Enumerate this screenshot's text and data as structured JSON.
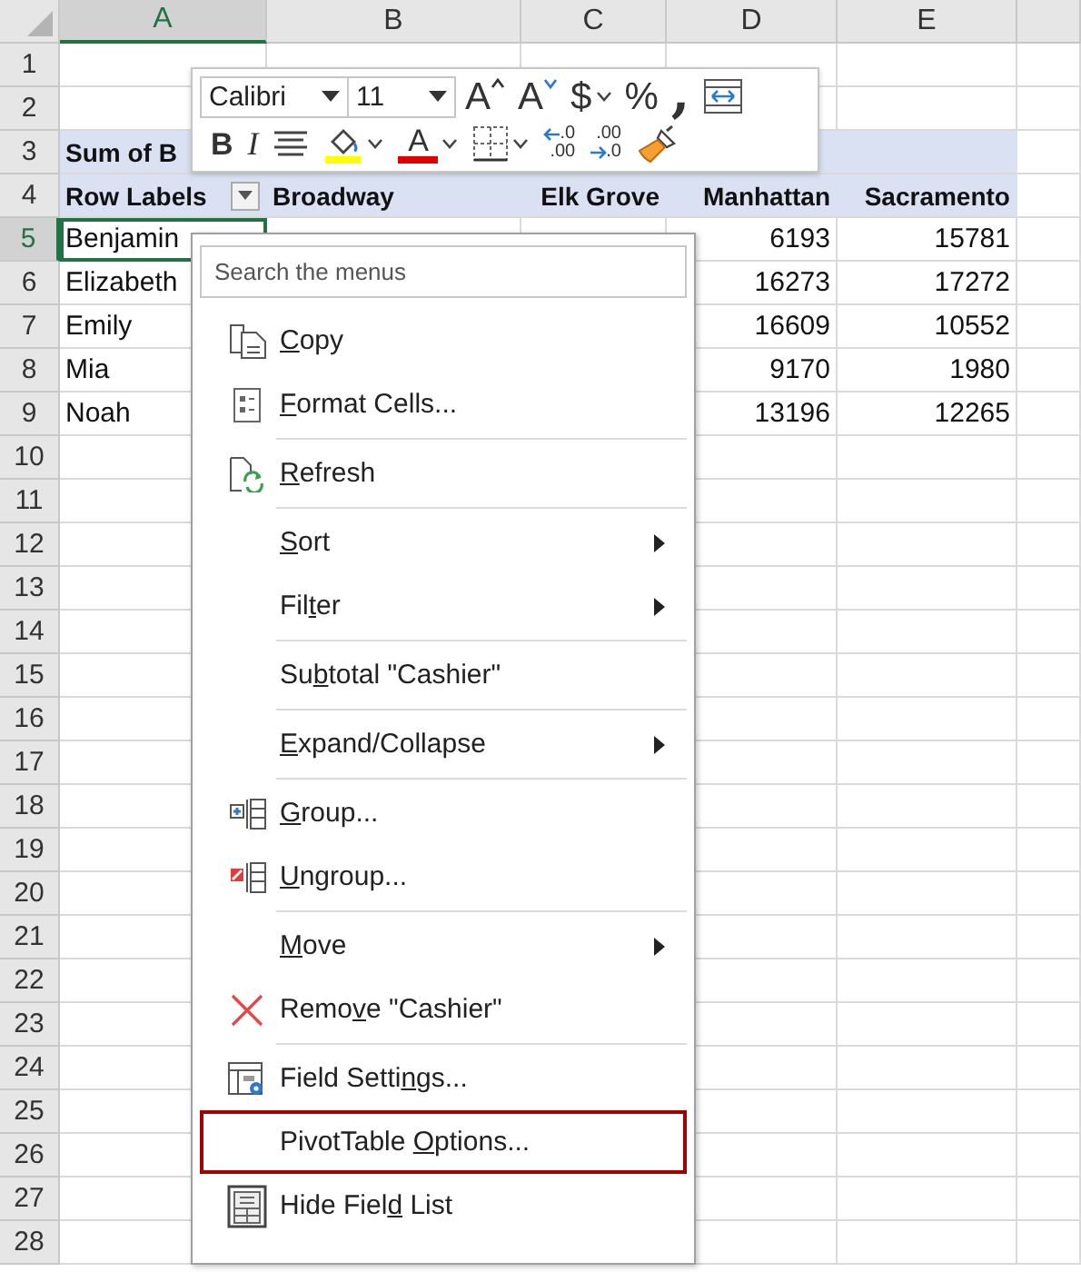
{
  "sheet": {
    "columns": [
      {
        "label": "A",
        "selected": true
      },
      {
        "label": "B",
        "selected": false
      },
      {
        "label": "C",
        "selected": false
      },
      {
        "label": "D",
        "selected": false
      },
      {
        "label": "E",
        "selected": false
      }
    ],
    "rows": [
      {
        "number": "1",
        "selected": false,
        "kind": "plain"
      },
      {
        "number": "2",
        "selected": false,
        "kind": "plain"
      },
      {
        "number": "3",
        "selected": false,
        "kind": "pivot-header",
        "cells": [
          {
            "text": "Sum of B",
            "kind": "label",
            "active": false
          }
        ]
      },
      {
        "number": "4",
        "selected": false,
        "kind": "pivot-header",
        "cells": [
          {
            "text": "Row Labels",
            "kind": "label",
            "active": false,
            "filter_button": true
          },
          {
            "text": "Broadway",
            "kind": "label",
            "active": false,
            "filter_button": false
          },
          {
            "text": "Elk Grove",
            "kind": "value",
            "active": false,
            "filter_button": false
          },
          {
            "text": "Manhattan",
            "kind": "value",
            "active": false,
            "filter_button": false
          },
          {
            "text": "Sacramento",
            "kind": "value",
            "active": false,
            "filter_button": false
          }
        ]
      },
      {
        "number": "5",
        "selected": true,
        "kind": "plain",
        "cells": [
          {
            "text": "Benjamin",
            "kind": "label",
            "active": true
          },
          null,
          null,
          {
            "text": "6193",
            "kind": "value",
            "active": false
          },
          {
            "text": "15781",
            "kind": "value",
            "active": false
          }
        ]
      },
      {
        "number": "6",
        "selected": false,
        "kind": "plain",
        "cells": [
          {
            "text": "Elizabeth",
            "kind": "label",
            "active": false
          },
          null,
          null,
          {
            "text": "16273",
            "kind": "value",
            "active": false
          },
          {
            "text": "17272",
            "kind": "value",
            "active": false
          }
        ]
      },
      {
        "number": "7",
        "selected": false,
        "kind": "plain",
        "cells": [
          {
            "text": "Emily",
            "kind": "label",
            "active": false
          },
          null,
          null,
          {
            "text": "16609",
            "kind": "value",
            "active": false
          },
          {
            "text": "10552",
            "kind": "value",
            "active": false
          }
        ]
      },
      {
        "number": "8",
        "selected": false,
        "kind": "plain",
        "cells": [
          {
            "text": "Mia",
            "kind": "label",
            "active": false
          },
          null,
          null,
          {
            "text": "9170",
            "kind": "value",
            "active": false
          },
          {
            "text": "1980",
            "kind": "value",
            "active": false
          }
        ]
      },
      {
        "number": "9",
        "selected": false,
        "kind": "plain",
        "cells": [
          {
            "text": "Noah",
            "kind": "label",
            "active": false
          },
          null,
          null,
          {
            "text": "13196",
            "kind": "value",
            "active": false
          },
          {
            "text": "12265",
            "kind": "value",
            "active": false
          }
        ]
      },
      {
        "number": "10",
        "selected": false,
        "kind": "plain"
      },
      {
        "number": "11",
        "selected": false,
        "kind": "plain"
      },
      {
        "number": "12",
        "selected": false,
        "kind": "plain"
      },
      {
        "number": "13",
        "selected": false,
        "kind": "plain"
      },
      {
        "number": "14",
        "selected": false,
        "kind": "plain"
      },
      {
        "number": "15",
        "selected": false,
        "kind": "plain"
      },
      {
        "number": "16",
        "selected": false,
        "kind": "plain"
      },
      {
        "number": "17",
        "selected": false,
        "kind": "plain"
      },
      {
        "number": "18",
        "selected": false,
        "kind": "plain"
      },
      {
        "number": "19",
        "selected": false,
        "kind": "plain"
      },
      {
        "number": "20",
        "selected": false,
        "kind": "plain"
      },
      {
        "number": "21",
        "selected": false,
        "kind": "plain"
      },
      {
        "number": "22",
        "selected": false,
        "kind": "plain"
      },
      {
        "number": "23",
        "selected": false,
        "kind": "plain"
      },
      {
        "number": "24",
        "selected": false,
        "kind": "plain"
      },
      {
        "number": "25",
        "selected": false,
        "kind": "plain"
      },
      {
        "number": "26",
        "selected": false,
        "kind": "plain"
      },
      {
        "number": "27",
        "selected": false,
        "kind": "plain"
      },
      {
        "number": "28",
        "selected": false,
        "kind": "plain"
      }
    ]
  },
  "mini_toolbar": {
    "font": {
      "value": "Calibri"
    },
    "size": {
      "value": "11"
    },
    "row_1": [
      {
        "kind": "grow-font",
        "glyph": "A",
        "dropdown": false
      },
      {
        "kind": "shrink-font",
        "glyph": "A",
        "dropdown": false
      },
      {
        "kind": "currency",
        "glyph": "$",
        "dropdown": true
      },
      {
        "kind": "percent",
        "glyph": "%",
        "dropdown": false
      },
      {
        "kind": "comma",
        "glyph": ",",
        "dropdown": false
      },
      {
        "kind": "wrap",
        "dropdown": false
      }
    ],
    "row_2": [
      {
        "kind": "bold",
        "glyph": "B",
        "dropdown": false
      },
      {
        "kind": "italic",
        "glyph": "I",
        "dropdown": false
      },
      {
        "kind": "align",
        "dropdown": false
      },
      {
        "kind": "fill-color",
        "dropdown": true
      },
      {
        "kind": "font-color",
        "glyph": "A",
        "dropdown": true
      },
      {
        "kind": "borders",
        "dropdown": true
      },
      {
        "kind": "increase-decimal",
        "top": ".0",
        "bottom": ".00",
        "dropdown": false
      },
      {
        "kind": "decrease-decimal",
        "top": ".00",
        "bottom": ".0",
        "dropdown": false
      },
      {
        "kind": "format-painter",
        "dropdown": false
      }
    ]
  },
  "context_menu": {
    "search": {
      "placeholder": "Search the menus"
    },
    "items": [
      {
        "kind": "copy",
        "key": "C",
        "post": "opy",
        "submenu": false,
        "highlighted": false
      },
      {
        "kind": "format-cells",
        "key": "F",
        "post": "ormat Cells...",
        "submenu": false,
        "highlighted": false
      },
      {
        "kind": "separator"
      },
      {
        "kind": "refresh",
        "key": "R",
        "post": "efresh",
        "submenu": false,
        "highlighted": false
      },
      {
        "kind": "separator"
      },
      {
        "kind": "plain",
        "key": "S",
        "post": "ort",
        "submenu": true,
        "highlighted": false
      },
      {
        "kind": "plain",
        "pre": "Fil",
        "key": "t",
        "post": "er",
        "submenu": true,
        "highlighted": false
      },
      {
        "kind": "separator"
      },
      {
        "kind": "plain",
        "pre": "Su",
        "key": "b",
        "post": "total \"Cashier\"",
        "submenu": false,
        "highlighted": false
      },
      {
        "kind": "separator"
      },
      {
        "kind": "plain",
        "key": "E",
        "post": "xpand/Collapse",
        "submenu": true,
        "highlighted": false
      },
      {
        "kind": "separator"
      },
      {
        "kind": "group",
        "key": "G",
        "post": "roup...",
        "submenu": false,
        "highlighted": false
      },
      {
        "kind": "ungroup",
        "key": "U",
        "post": "ngroup...",
        "submenu": false,
        "highlighted": false
      },
      {
        "kind": "separator"
      },
      {
        "kind": "plain",
        "key": "M",
        "post": "ove",
        "submenu": true,
        "highlighted": false
      },
      {
        "kind": "remove",
        "pre": "Remo",
        "key": "v",
        "post": "e \"Cashier\"",
        "submenu": false,
        "highlighted": false
      },
      {
        "kind": "separator"
      },
      {
        "kind": "field-settings",
        "pre": "Field Setti",
        "key": "n",
        "post": "gs...",
        "submenu": false,
        "highlighted": false
      },
      {
        "kind": "plain",
        "pre": "PivotTable ",
        "key": "O",
        "post": "ptions...",
        "submenu": false,
        "highlighted": true
      },
      {
        "kind": "field-list",
        "pre": "Hide Fiel",
        "key": "d",
        "post": " List",
        "submenu": false,
        "highlighted": false
      }
    ]
  }
}
